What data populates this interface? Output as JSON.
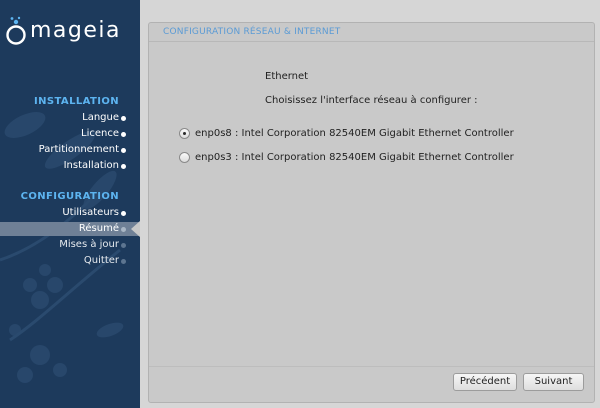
{
  "sidebar": {
    "logo_text": "mageia",
    "sections": [
      {
        "title": "INSTALLATION",
        "items": [
          {
            "label": "Langue",
            "state": "done"
          },
          {
            "label": "Licence",
            "state": "done"
          },
          {
            "label": "Partitionnement",
            "state": "done"
          },
          {
            "label": "Installation",
            "state": "done"
          }
        ]
      },
      {
        "title": "CONFIGURATION",
        "items": [
          {
            "label": "Utilisateurs",
            "state": "done"
          },
          {
            "label": "Résumé",
            "state": "current"
          },
          {
            "label": "Mises à jour",
            "state": "future"
          },
          {
            "label": "Quitter",
            "state": "future"
          }
        ]
      }
    ]
  },
  "content": {
    "header": "CONFIGURATION RÉSEAU & INTERNET",
    "interface_type": "Ethernet",
    "prompt": "Choisissez l'interface réseau à configurer :",
    "options": [
      {
        "label": "enp0s8 : Intel Corporation 82540EM Gigabit Ethernet Controller",
        "checked": true
      },
      {
        "label": "enp0s3 : Intel Corporation 82540EM Gigabit Ethernet Controller",
        "checked": false
      }
    ],
    "buttons": {
      "previous": "Précédent",
      "next": "Suivant"
    }
  },
  "colors": {
    "sidebar_bg": "#1d3a5c",
    "section_title": "#5db4f0",
    "header_text": "#5b9bd5",
    "content_bg": "#c9c9c9"
  }
}
